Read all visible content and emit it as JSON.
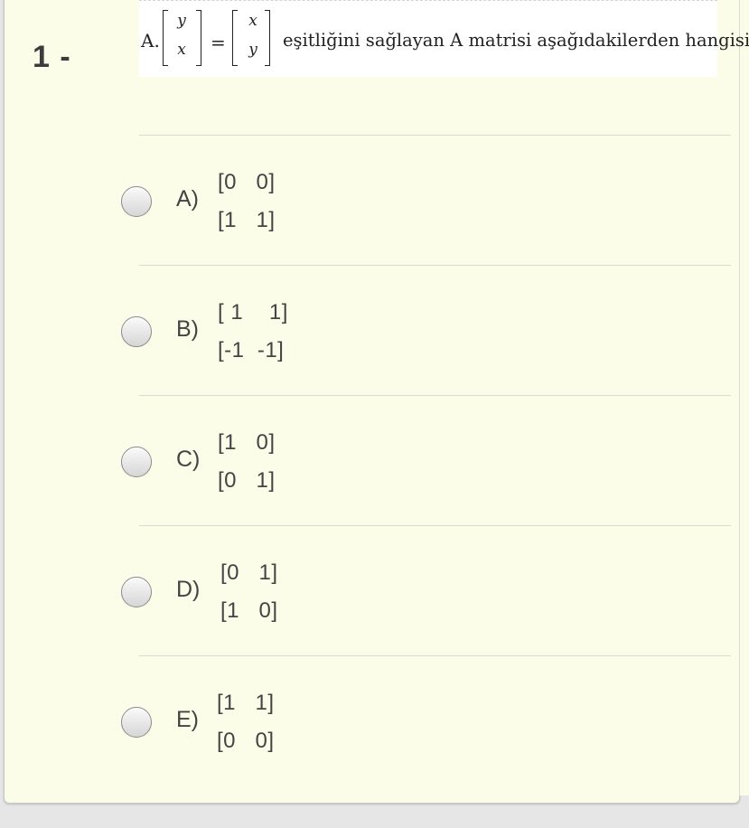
{
  "question": {
    "number_label": "1 -",
    "lhs": "A.",
    "vector_left": [
      "y",
      "x"
    ],
    "equals": "=",
    "vector_right": [
      "x",
      "y"
    ],
    "text": "eşitliğini sağlayan A matrisi aşağıdakilerden hangisidir?"
  },
  "options": [
    {
      "label": "A)",
      "rows": [
        "[0   0]",
        "[1   1]"
      ]
    },
    {
      "label": "B)",
      "rows": [
        "[ 1    1]",
        "[-1  -1]"
      ]
    },
    {
      "label": "C)",
      "rows": [
        "[1   0]",
        "[0   1]"
      ]
    },
    {
      "label": "D)",
      "rows": [
        "[0   1]",
        "[1   0]"
      ]
    },
    {
      "label": "E)",
      "rows": [
        "[1   1]",
        "[0   0]"
      ]
    }
  ]
}
